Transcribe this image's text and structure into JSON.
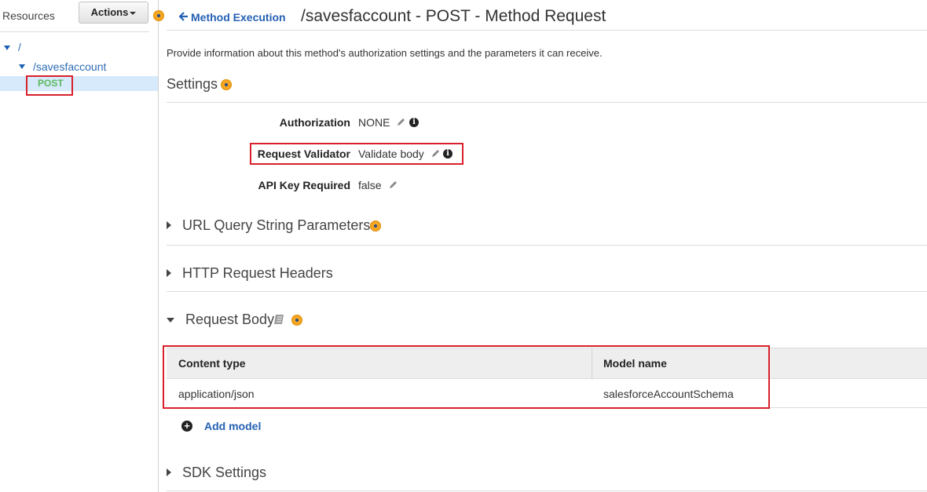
{
  "sidebar": {
    "resources_label": "Resources",
    "actions_label": "Actions",
    "tree": [
      {
        "label": "/",
        "expanded": true
      },
      {
        "label": "/savesfaccount",
        "expanded": true
      },
      {
        "label": "POST",
        "selected": true
      }
    ]
  },
  "header": {
    "back_link": "Method Execution",
    "title": "/savesfaccount - POST - Method Request"
  },
  "description": "Provide information about this method's authorization settings and the parameters it can receive.",
  "settings": {
    "title": "Settings",
    "authorization": {
      "label": "Authorization",
      "value": "NONE"
    },
    "request_validator": {
      "label": "Request Validator",
      "value": "Validate body"
    },
    "api_key_required": {
      "label": "API Key Required",
      "value": "false"
    }
  },
  "sections": {
    "url_query": "URL Query String Parameters",
    "http_headers": "HTTP Request Headers",
    "request_body": "Request Body",
    "sdk_settings": "SDK Settings"
  },
  "request_body_table": {
    "columns": [
      "Content type",
      "Model name"
    ],
    "rows": [
      [
        "application/json",
        "salesforceAccountSchema"
      ]
    ]
  },
  "add_model_label": "Add model",
  "colors": {
    "link_blue": "#2561b3",
    "highlight_red": "#d9202a",
    "help_orange": "#f5a623",
    "post_green": "#5bb85b",
    "selection_blue": "#d6eafc"
  },
  "icons": [
    "help-icon",
    "pencil-icon",
    "info-icon",
    "book-icon",
    "plus-circle-icon",
    "back-arrow-icon",
    "caret-down-icon"
  ]
}
